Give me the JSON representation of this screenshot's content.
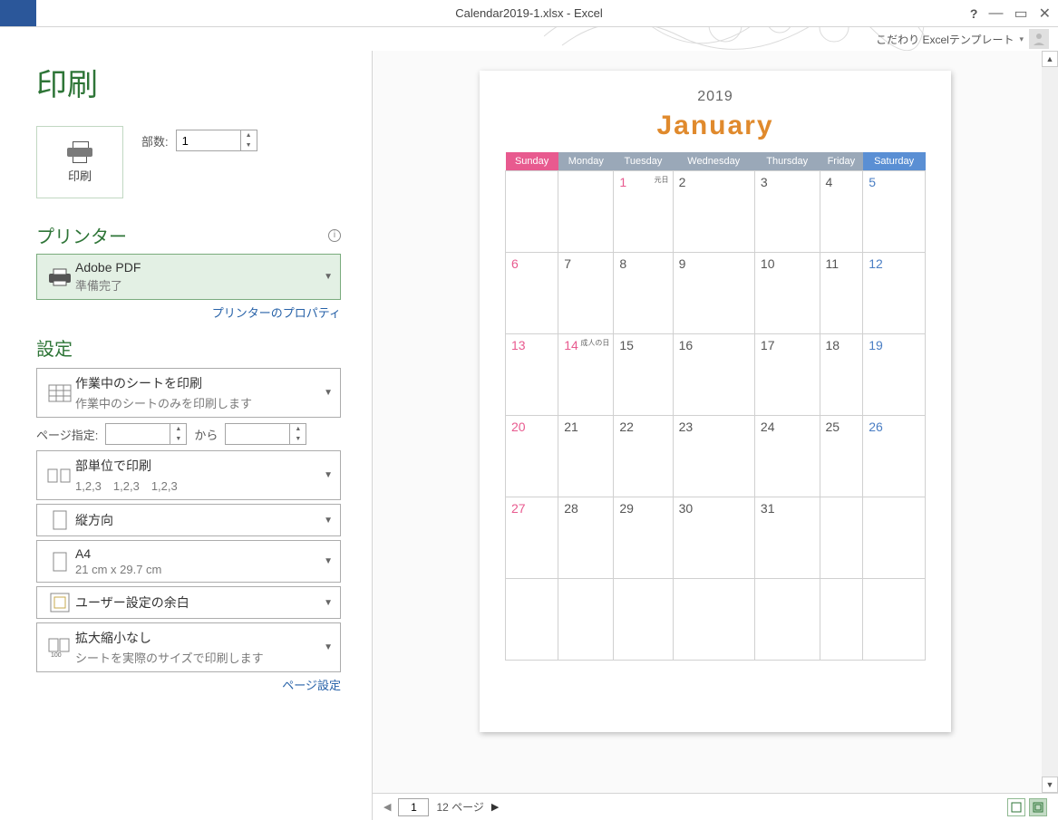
{
  "title": "Calendar2019-1.xlsx - Excel",
  "user_name": "こだわり Excelテンプレート",
  "page_heading": "印刷",
  "print_button": "印刷",
  "copies_label": "部数:",
  "copies_value": "1",
  "printer_section": "プリンター",
  "printer": {
    "name": "Adobe PDF",
    "status": "準備完了"
  },
  "printer_properties": "プリンターのプロパティ",
  "settings_section": "設定",
  "settings": {
    "what": {
      "title": "作業中のシートを印刷",
      "sub": "作業中のシートのみを印刷します"
    },
    "page_range_label": "ページ指定:",
    "page_range_to": "から",
    "collate": {
      "title": "部単位で印刷",
      "sub": "1,2,3　1,2,3　1,2,3"
    },
    "orientation": {
      "title": "縦方向"
    },
    "paper": {
      "title": "A4",
      "sub": "21 cm x 29.7 cm"
    },
    "margins": {
      "title": "ユーザー設定の余白"
    },
    "scaling": {
      "title": "拡大縮小なし",
      "sub": "シートを実際のサイズで印刷します"
    }
  },
  "page_setup": "ページ設定",
  "calendar": {
    "year": "2019",
    "month": "January",
    "days": [
      "Sunday",
      "Monday",
      "Tuesday",
      "Wednesday",
      "Thursday",
      "Friday",
      "Saturday"
    ],
    "weeks": [
      [
        {
          "n": ""
        },
        {
          "n": ""
        },
        {
          "n": "1",
          "note": "元日",
          "h": true
        },
        {
          "n": "2"
        },
        {
          "n": "3"
        },
        {
          "n": "4"
        },
        {
          "n": "5"
        }
      ],
      [
        {
          "n": "6"
        },
        {
          "n": "7"
        },
        {
          "n": "8"
        },
        {
          "n": "9"
        },
        {
          "n": "10"
        },
        {
          "n": "11"
        },
        {
          "n": "12"
        }
      ],
      [
        {
          "n": "13"
        },
        {
          "n": "14",
          "note": "成人の日",
          "h": true
        },
        {
          "n": "15"
        },
        {
          "n": "16"
        },
        {
          "n": "17"
        },
        {
          "n": "18"
        },
        {
          "n": "19"
        }
      ],
      [
        {
          "n": "20"
        },
        {
          "n": "21"
        },
        {
          "n": "22"
        },
        {
          "n": "23"
        },
        {
          "n": "24"
        },
        {
          "n": "25"
        },
        {
          "n": "26"
        }
      ],
      [
        {
          "n": "27"
        },
        {
          "n": "28"
        },
        {
          "n": "29"
        },
        {
          "n": "30"
        },
        {
          "n": "31"
        },
        {
          "n": ""
        },
        {
          "n": ""
        }
      ],
      [
        {
          "n": ""
        },
        {
          "n": ""
        },
        {
          "n": ""
        },
        {
          "n": ""
        },
        {
          "n": ""
        },
        {
          "n": ""
        },
        {
          "n": ""
        }
      ]
    ]
  },
  "nav": {
    "current": "1",
    "total": "12 ページ"
  }
}
